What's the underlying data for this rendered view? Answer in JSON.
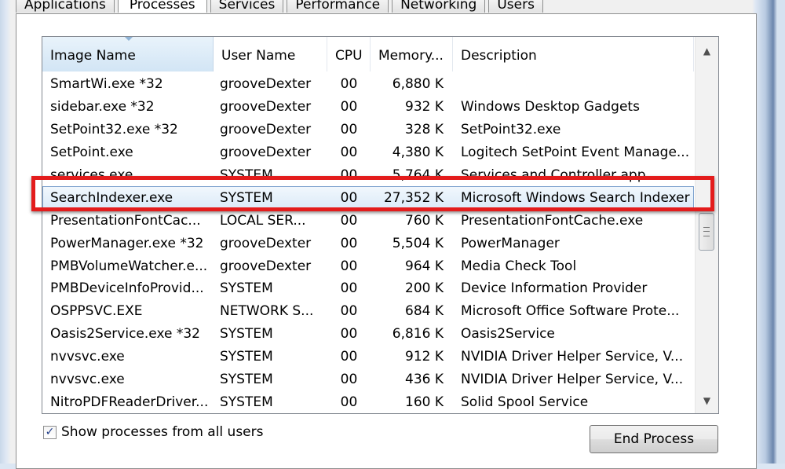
{
  "tabs": [
    {
      "label": "Applications",
      "active": false
    },
    {
      "label": "Processes",
      "active": true
    },
    {
      "label": "Services",
      "active": false
    },
    {
      "label": "Performance",
      "active": false
    },
    {
      "label": "Networking",
      "active": false
    },
    {
      "label": "Users",
      "active": false
    }
  ],
  "table": {
    "columns": [
      "Image Name",
      "User Name",
      "CPU",
      "Memory...",
      "Description"
    ],
    "rows": [
      {
        "image": "SmartWi.exe *32",
        "user": "grooveDexter",
        "cpu": "00",
        "memory": "6,880 K",
        "description": ""
      },
      {
        "image": "sidebar.exe *32",
        "user": "grooveDexter",
        "cpu": "00",
        "memory": "932 K",
        "description": "Windows Desktop Gadgets"
      },
      {
        "image": "SetPoint32.exe *32",
        "user": "grooveDexter",
        "cpu": "00",
        "memory": "328 K",
        "description": "SetPoint32.exe"
      },
      {
        "image": "SetPoint.exe",
        "user": "grooveDexter",
        "cpu": "00",
        "memory": "4,380 K",
        "description": "Logitech SetPoint Event Manage..."
      },
      {
        "image": "services.exe",
        "user": "SYSTEM",
        "cpu": "00",
        "memory": "5,764 K",
        "description": "Services and Controller app"
      },
      {
        "image": "SearchIndexer.exe",
        "user": "SYSTEM",
        "cpu": "00",
        "memory": "27,352 K",
        "description": "Microsoft Windows Search Indexer"
      },
      {
        "image": "PresentationFontCac...",
        "user": "LOCAL SER...",
        "cpu": "00",
        "memory": "760 K",
        "description": "PresentationFontCache.exe"
      },
      {
        "image": "PowerManager.exe *32",
        "user": "grooveDexter",
        "cpu": "00",
        "memory": "5,504 K",
        "description": "PowerManager"
      },
      {
        "image": "PMBVolumeWatcher.e...",
        "user": "grooveDexter",
        "cpu": "00",
        "memory": "964 K",
        "description": "Media Check Tool"
      },
      {
        "image": "PMBDeviceInfoProvid...",
        "user": "SYSTEM",
        "cpu": "00",
        "memory": "200 K",
        "description": "Device Information Provider"
      },
      {
        "image": "OSPPSVC.EXE",
        "user": "NETWORK S...",
        "cpu": "00",
        "memory": "684 K",
        "description": "Microsoft Office Software Prote..."
      },
      {
        "image": "Oasis2Service.exe *32",
        "user": "SYSTEM",
        "cpu": "00",
        "memory": "6,816 K",
        "description": "Oasis2Service"
      },
      {
        "image": "nvvsvc.exe",
        "user": "SYSTEM",
        "cpu": "00",
        "memory": "912 K",
        "description": "NVIDIA Driver Helper Service, V..."
      },
      {
        "image": "nvvsvc.exe",
        "user": "SYSTEM",
        "cpu": "00",
        "memory": "436 K",
        "description": "NVIDIA Driver Helper Service, V..."
      },
      {
        "image": "NitroPDFReaderDriver...",
        "user": "SYSTEM",
        "cpu": "00",
        "memory": "160 K",
        "description": "Solid Spool Service"
      }
    ],
    "selected_index": 5
  },
  "show_all_users": {
    "label": "Show processes from all users",
    "checked": true,
    "glyph": "✓"
  },
  "end_process_label": "End Process",
  "icons": {
    "scroll_up": "▲",
    "scroll_down": "▼"
  }
}
